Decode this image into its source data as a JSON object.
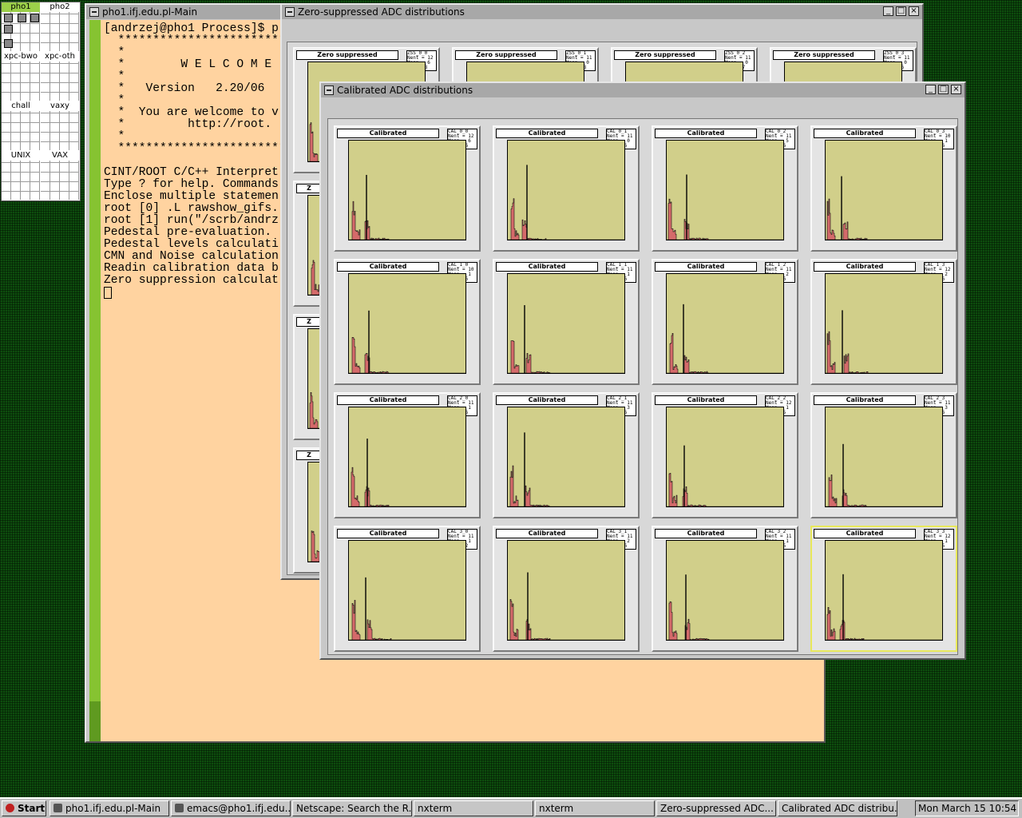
{
  "colors": {
    "desktop": "#0d4d0d",
    "terminal_bg": "#ffd3a0",
    "scrollbar": "#86c331",
    "plot_frame": "#d1cf8a",
    "histogram_fill": "#d46a6a"
  },
  "pager": {
    "desks": [
      {
        "label": "pho1",
        "active": true
      },
      {
        "label": "pho2",
        "active": false
      },
      {
        "label": "xpc-bwo",
        "active": false
      },
      {
        "label": "xpc-oth",
        "active": false
      },
      {
        "label": "chall",
        "active": false
      },
      {
        "label": "vaxy",
        "active": false
      },
      {
        "label": "UNIX",
        "active": false
      },
      {
        "label": "VAX",
        "active": false
      }
    ]
  },
  "terminal": {
    "title": "pho1.ifj.edu.pl-Main",
    "lines": [
      "[andrzej@pho1 Process]$ p",
      "  ************************",
      "  *",
      "  *        W E L C O M E",
      "  *",
      "  *   Version   2.20/06",
      "  *",
      "  *  You are welcome to v",
      "  *         http://root.",
      "  *",
      "  ************************",
      "",
      "CINT/ROOT C/C++ Interpret",
      "Type ? for help. Commands",
      "Enclose multiple statemen",
      "root [0] .L rawshow_gifs.",
      "root [1] run(\"/scrb/andrz",
      "Pedestal pre-evaluation.",
      "Pedestal levels calculati",
      "CMN and Noise calculation",
      "Readin calibration data b",
      "Zero suppression calculat"
    ]
  },
  "zero_window": {
    "title": "Zero-suppressed ADC distributions",
    "pad_title": "Zero suppressed",
    "stats": [
      [
        "ZSS_0_0",
        "Nent = 12",
        "Mean = 6",
        "RMS = 8"
      ],
      [
        "ZSS_0_1",
        "Nent = 11",
        "Mean = 0",
        "RMS = 8"
      ],
      [
        "ZSS_0_2",
        "Nent = 11",
        "Mean = 0",
        "RMS = 7"
      ],
      [
        "ZSS_0_3",
        "Nent = 11",
        "Mean = 0",
        "RMS = 6"
      ]
    ],
    "row_labels": [
      "Z",
      "Z",
      "Z"
    ]
  },
  "cal_window": {
    "title": "Calibrated ADC distributions",
    "pad_title": "Calibrated",
    "stats": [
      [
        "CAL_0_0",
        "Nent = 12",
        "Mean = 6",
        "RMS = 6"
      ],
      [
        "CAL_0_1",
        "Nent = 11",
        "Mean = 0",
        "RMS = 6"
      ],
      [
        "CAL_0_2",
        "Nent = 11",
        "Mean = 5",
        "RMS = 6"
      ],
      [
        "CAL_0_3",
        "Nent = 10",
        "Mean = 1",
        "RMS = 6"
      ],
      [
        "CAL_1_0",
        "Nent = 10",
        "Mean = 1",
        "RMS = 6"
      ],
      [
        "CAL_1_1",
        "Nent = 11",
        "Mean = 1",
        "RMS = 6"
      ],
      [
        "CAL_1_2",
        "Nent = 11",
        "Mean = 2",
        "RMS = 6"
      ],
      [
        "CAL_1_3",
        "Nent = 12",
        "Mean = 2",
        "RMS = 6"
      ],
      [
        "CAL_2_0",
        "Nent = 11",
        "Mean = 1",
        "RMS = 6"
      ],
      [
        "CAL_2_1",
        "Nent = 11",
        "Mean = 3",
        "RMS = 6"
      ],
      [
        "CAL_2_2",
        "Nent = 12",
        "Mean = 1",
        "RMS = 5"
      ],
      [
        "CAL_2_3",
        "Nent = 11",
        "Mean = 3",
        "RMS = 6"
      ],
      [
        "CAL_3_0",
        "Nent = 11",
        "Mean = 1",
        "RMS = 2"
      ],
      [
        "CAL_3_1",
        "Nent = 11",
        "Mean = 2",
        "RMS = 6"
      ],
      [
        "CAL_3_2",
        "Nent = 11",
        "Mean = 1",
        "RMS = 5"
      ],
      [
        "CAL_3_3",
        "Nent = 12",
        "Mean = 1",
        "RMS = 5"
      ]
    ]
  },
  "taskbar": {
    "start": "Start",
    "items": [
      "pho1.ifj.edu.pl-Main",
      "emacs@pho1.ifj.edu....",
      "Netscape: Search the R...",
      "nxterm",
      "nxterm",
      "Zero-suppressed ADC...",
      "Calibrated ADC distribu..."
    ],
    "clock": "Mon March 15 10:54"
  }
}
